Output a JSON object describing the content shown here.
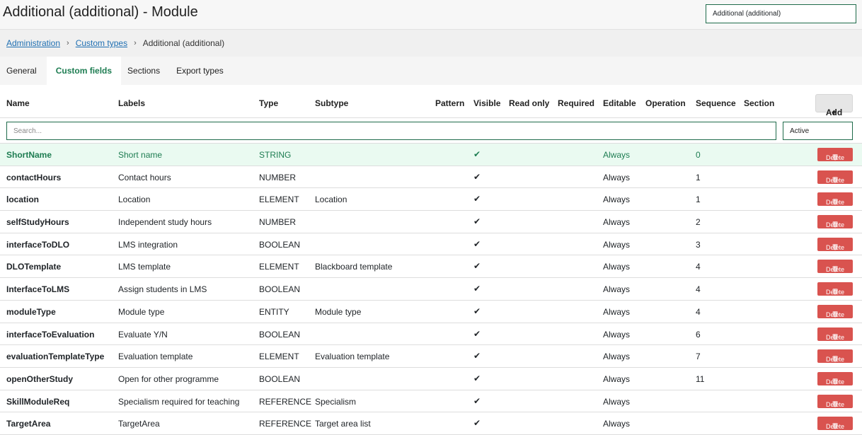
{
  "header": {
    "title": "Additional (additional) - Module",
    "select_value": "Additional (additional)"
  },
  "breadcrumb": {
    "items": [
      "Administration",
      "Custom types"
    ],
    "current": "Additional (additional)",
    "separator_icon": "chevron-right-icon"
  },
  "tabs": [
    {
      "label": "General",
      "active": false
    },
    {
      "label": "Custom fields",
      "active": true
    },
    {
      "label": "Sections",
      "active": false
    },
    {
      "label": "Export types",
      "active": false
    }
  ],
  "table": {
    "columns": [
      "Name",
      "Labels",
      "Type",
      "Subtype",
      "Pattern",
      "Visible",
      "Read only",
      "Required",
      "Editable",
      "Operation",
      "Sequence",
      "Section"
    ],
    "add_label": "Add",
    "search_placeholder": "Search...",
    "status_filter": "Active",
    "delete_label": "Delete",
    "visible_icon": "checkmark-icon",
    "delete_icon": "trash-icon",
    "accent_color": "#1e7d52",
    "delete_color": "#d9534f",
    "rows": [
      {
        "name": "ShortName",
        "label": "Short name",
        "type": "STRING",
        "subtype": "",
        "visible": "✔",
        "editable": "Always",
        "sequence": "0",
        "highlight": true
      },
      {
        "name": "contactHours",
        "label": "Contact hours",
        "type": "NUMBER",
        "subtype": "",
        "visible": "✔",
        "editable": "Always",
        "sequence": "1"
      },
      {
        "name": "location",
        "label": "Location",
        "type": "ELEMENT",
        "subtype": "Location",
        "visible": "✔",
        "editable": "Always",
        "sequence": "1"
      },
      {
        "name": "selfStudyHours",
        "label": "Independent study hours",
        "type": "NUMBER",
        "subtype": "",
        "visible": "✔",
        "editable": "Always",
        "sequence": "2"
      },
      {
        "name": "interfaceToDLO",
        "label": "LMS integration",
        "type": "BOOLEAN",
        "subtype": "",
        "visible": "✔",
        "editable": "Always",
        "sequence": "3"
      },
      {
        "name": "DLOTemplate",
        "label": "LMS template",
        "type": "ELEMENT",
        "subtype": "Blackboard template",
        "visible": "✔",
        "editable": "Always",
        "sequence": "4"
      },
      {
        "name": "InterfaceToLMS",
        "label": "Assign students in LMS",
        "type": "BOOLEAN",
        "subtype": "",
        "visible": "✔",
        "editable": "Always",
        "sequence": "4"
      },
      {
        "name": "moduleType",
        "label": "Module type",
        "type": "ENTITY",
        "subtype": "Module type",
        "visible": "✔",
        "editable": "Always",
        "sequence": "4"
      },
      {
        "name": "interfaceToEvaluation",
        "label": "Evaluate Y/N",
        "type": "BOOLEAN",
        "subtype": "",
        "visible": "✔",
        "editable": "Always",
        "sequence": "6"
      },
      {
        "name": "evaluationTemplateType",
        "label": "Evaluation template",
        "type": "ELEMENT",
        "subtype": "Evaluation template",
        "visible": "✔",
        "editable": "Always",
        "sequence": "7"
      },
      {
        "name": "openOtherStudy",
        "label": "Open for other programme",
        "type": "BOOLEAN",
        "subtype": "",
        "visible": "✔",
        "editable": "Always",
        "sequence": "11"
      },
      {
        "name": "SkillModuleReq",
        "label": "Specialism required for teaching",
        "type": "REFERENCE",
        "subtype": "Specialism",
        "visible": "✔",
        "editable": "Always",
        "sequence": ""
      },
      {
        "name": "TargetArea",
        "label": "TargetArea",
        "type": "REFERENCE",
        "subtype": "Target area list",
        "visible": "✔",
        "editable": "Always",
        "sequence": ""
      }
    ]
  }
}
